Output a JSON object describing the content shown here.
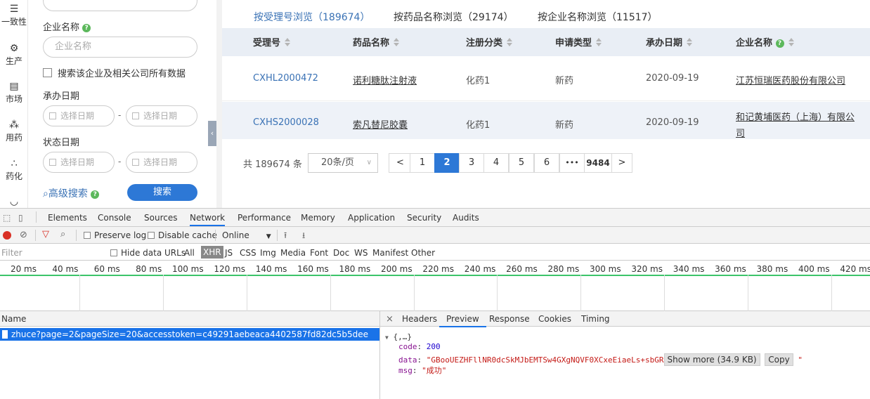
{
  "rail": {
    "items": [
      {
        "label": "一致性",
        "icon": "list-icon"
      },
      {
        "label": "生产",
        "icon": "gears-icon"
      },
      {
        "label": "市场",
        "icon": "clipboard-icon"
      },
      {
        "label": "用药",
        "icon": "pills-icon"
      },
      {
        "label": "药化",
        "icon": "molecule-icon"
      }
    ]
  },
  "filter": {
    "company_label": "企业名称",
    "company_placeholder": "企业名称",
    "search_related_label": "搜索该企业及相关公司所有数据",
    "handle_date_label": "承办日期",
    "status_date_label": "状态日期",
    "date_placeholder": "选择日期",
    "date_dash": "-",
    "advanced_search": "高级搜索",
    "search_button": "搜索"
  },
  "main": {
    "tabs": [
      {
        "label": "按受理号浏览（189674）",
        "active": true
      },
      {
        "label": "按药品名称浏览（29174）",
        "active": false
      },
      {
        "label": "按企业名称浏览（11517）",
        "active": false
      }
    ],
    "columns": [
      "受理号",
      "药品名称",
      "注册分类",
      "申请类型",
      "承办日期",
      "企业名称"
    ],
    "rows": [
      [
        "CXHL2000472",
        "诺利糖肽注射液",
        "化药1",
        "新药",
        "2020-09-19",
        "江苏恒瑞医药股份有限公司"
      ],
      [
        "CXHS2000028",
        "索凡替尼胶囊",
        "化药1",
        "新药",
        "2020-09-19",
        "和记黄埔医药（上海）有限公",
        "司"
      ]
    ],
    "total": "共 189674 条",
    "page_size": "20条/页",
    "pages": [
      "1",
      "2",
      "3",
      "4",
      "5",
      "6",
      "•••",
      "9484"
    ],
    "current_page": "2",
    "prev": "<",
    "next": ">"
  },
  "devtools": {
    "tabs": [
      "Elements",
      "Console",
      "Sources",
      "Network",
      "Performance",
      "Memory",
      "Application",
      "Security",
      "Audits"
    ],
    "active_tab": "Network",
    "toolbar": {
      "preserve_log": "Preserve log",
      "disable_cache": "Disable cache",
      "throttle": "Online"
    },
    "filter_placeholder": "Filter",
    "hide_data_urls": "Hide data URLs",
    "types": [
      "All",
      "XHR",
      "JS",
      "CSS",
      "Img",
      "Media",
      "Font",
      "Doc",
      "WS",
      "Manifest",
      "Other"
    ],
    "active_type": "XHR",
    "ticks": [
      "20 ms",
      "40 ms",
      "60 ms",
      "80 ms",
      "100 ms",
      "120 ms",
      "140 ms",
      "160 ms",
      "180 ms",
      "200 ms",
      "220 ms",
      "240 ms",
      "260 ms",
      "280 ms",
      "300 ms",
      "320 ms",
      "340 ms",
      "360 ms",
      "380 ms",
      "400 ms",
      "420 ms"
    ],
    "name_header": "Name",
    "request": "zhuce?page=2&pageSize=20&accesstoken=c49291aebeaca4402587fd82dc5b5dee",
    "detail_tabs": [
      "Headers",
      "Preview",
      "Response",
      "Cookies",
      "Timing"
    ],
    "active_detail_tab": "Preview",
    "close": "×",
    "preview": {
      "root": "{,…}",
      "code_key": "code",
      "code_val": "200",
      "data_key": "data",
      "data_val": "\"GBooUEZHFllNR0dcSkMJbEMTSw4GXgNQVF0XCxeEiaeLs+sbGR",
      "show_more": "Show more (34.9 KB)",
      "copy": "Copy",
      "data_end": "\"",
      "msg_key": "msg",
      "msg_val": "\"成功\""
    }
  }
}
